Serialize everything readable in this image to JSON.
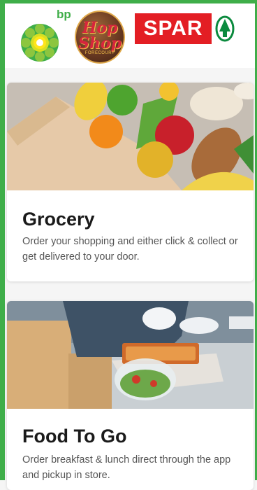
{
  "brands": {
    "bp_text": "bp",
    "hop_line1": "Hop",
    "hop_line2": "Shop",
    "hop_sub": "FORECOURT",
    "spar_text": "SPAR"
  },
  "colors": {
    "frame": "#3fae49",
    "spar_red": "#e31e24",
    "bp_green": "#3fae49",
    "bp_yellow": "#ffe51a"
  },
  "cards": [
    {
      "title": "Grocery",
      "description": "Order your shopping and either click & collect or get delivered to your door."
    },
    {
      "title": "Food To Go",
      "description": "Order breakfast & lunch direct through the app and pickup in store."
    }
  ]
}
